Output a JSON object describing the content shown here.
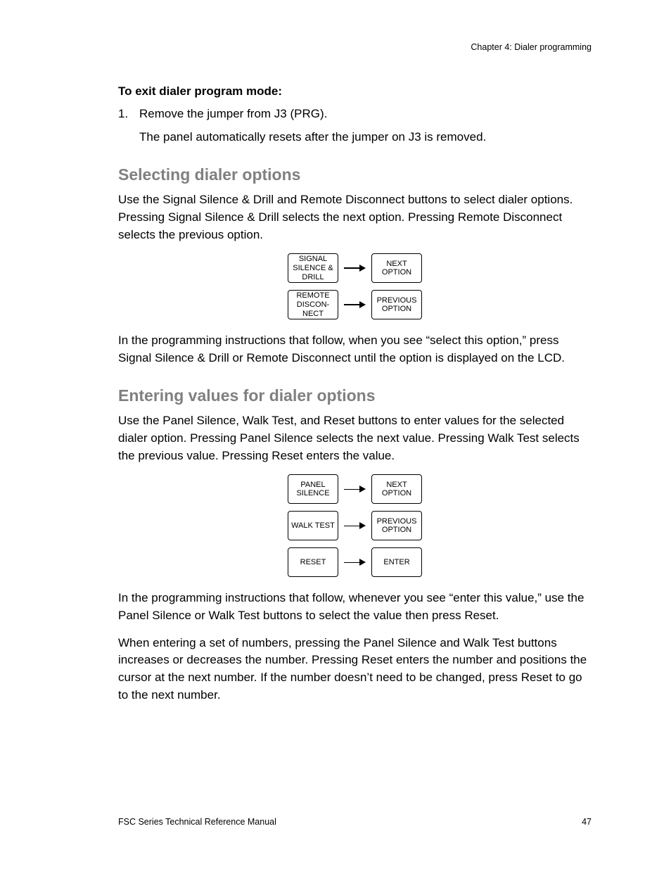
{
  "header": {
    "chapter": "Chapter 4: Dialer programming"
  },
  "s1": {
    "title": "To exit dialer program mode:",
    "step_num": "1.",
    "step_text": "Remove the jumper from J3 (PRG).",
    "step_body": "The panel automatically resets after the jumper on J3 is removed."
  },
  "s2": {
    "heading": "Selecting dialer options",
    "p1": "Use the Signal Silence & Drill and Remote Disconnect buttons to select dialer options. Pressing Signal Silence & Drill selects the next option. Pressing Remote Disconnect selects the previous option.",
    "diagram": {
      "r1": {
        "left": "SIGNAL SILENCE & DRILL",
        "right": "NEXT OPTION"
      },
      "r2": {
        "left": "REMOTE DISCON-NECT",
        "right": "PREVIOUS OPTION"
      }
    },
    "p2": "In the programming instructions that follow, when you see “select this option,” press Signal Silence & Drill or Remote Disconnect until the option is displayed on the LCD."
  },
  "s3": {
    "heading": "Entering values for dialer options",
    "p1": "Use the Panel Silence, Walk Test, and Reset buttons to enter values for the selected dialer option. Pressing Panel Silence selects the next value. Pressing Walk Test selects the previous value. Pressing Reset enters the value.",
    "diagram": {
      "r1": {
        "left": "PANEL SILENCE",
        "right": "NEXT OPTION"
      },
      "r2": {
        "left": "WALK TEST",
        "right": "PREVIOUS OPTION"
      },
      "r3": {
        "left": "RESET",
        "right": "ENTER"
      }
    },
    "p2": "In the programming instructions that follow, whenever you see “enter this value,” use the Panel Silence or Walk Test buttons to select the value then press Reset.",
    "p3": "When entering a set of numbers, pressing the Panel Silence and Walk Test buttons increases or decreases the number. Pressing Reset enters the number and positions the cursor at the next number. If the number doesn’t need to be changed, press Reset to go to the next number."
  },
  "footer": {
    "title": "FSC Series Technical Reference Manual",
    "page": "47"
  }
}
